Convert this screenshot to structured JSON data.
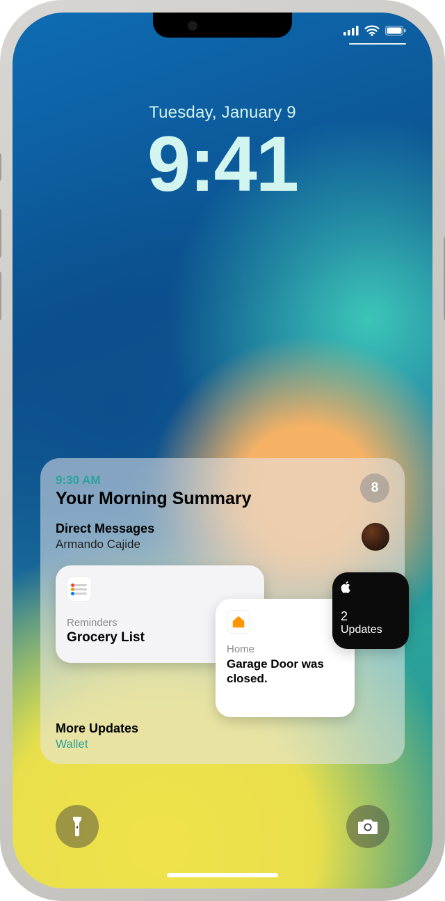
{
  "status": {
    "cellular_bars": 4,
    "wifi_bars": 3,
    "battery_pct": 100
  },
  "lock": {
    "date": "Tuesday, January 9",
    "time": "9:41"
  },
  "summary": {
    "time": "9:30 AM",
    "title": "Your Morning Summary",
    "count": "8",
    "direct_messages": {
      "label": "Direct Messages",
      "sender": "Armando Cajide"
    },
    "tiles": {
      "reminders": {
        "app": "Reminders",
        "title": "Grocery List"
      },
      "home": {
        "app": "Home",
        "body": "Garage Door was closed."
      },
      "updates": {
        "count": "2",
        "label": "Updates"
      }
    },
    "more": {
      "label": "More Updates",
      "app": "Wallet"
    }
  },
  "quick": {
    "flashlight": "flashlight",
    "camera": "camera"
  }
}
